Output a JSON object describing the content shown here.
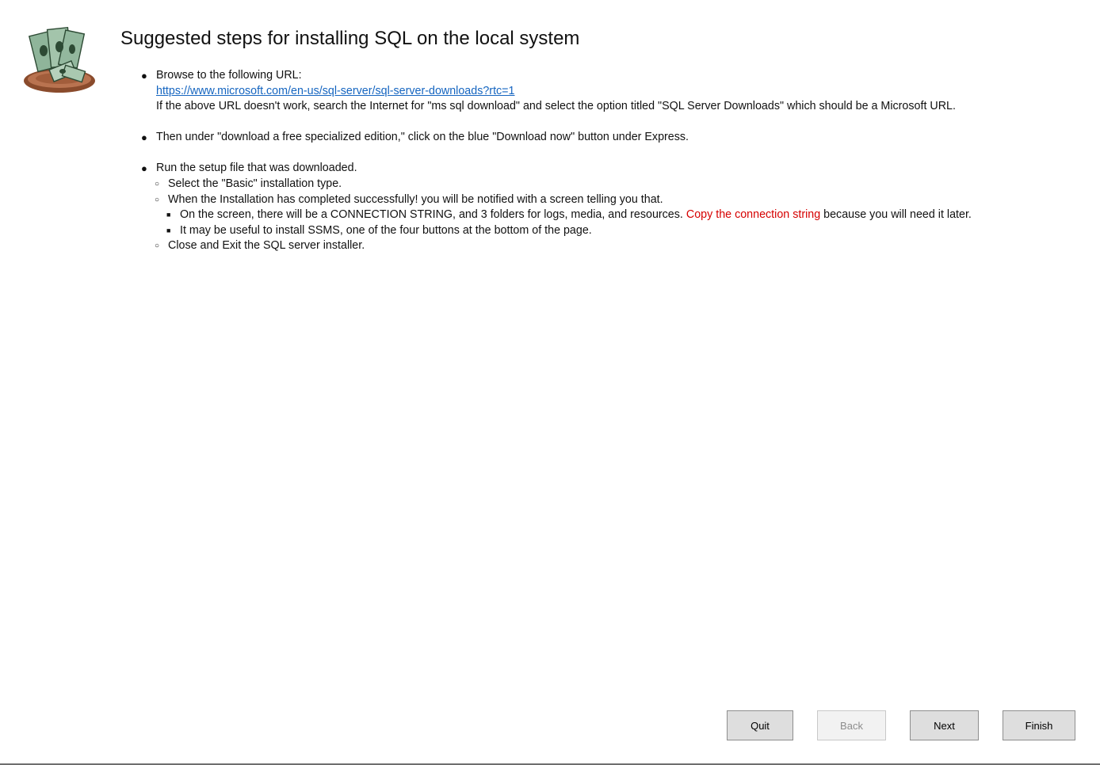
{
  "page": {
    "title": "Suggested steps for installing SQL on the local system"
  },
  "steps": {
    "browse_label": "Browse to the following URL:",
    "url": "https://www.microsoft.com/en-us/sql-server/sql-server-downloads?rtc=1",
    "fallback_note": "If the above URL doesn't work, search the Internet for \"ms sql download\" and select the option titled \"SQL Server Downloads\" which should be a Microsoft URL.",
    "download_instruction": "Then under \"download a free specialized edition,\" click on the blue \"Download now\" button under Express.",
    "run_setup": "Run the setup file that was downloaded.",
    "select_basic": "Select the \"Basic\" installation type.",
    "completed_note": "When the Installation has completed successfully! you will be notified with a screen telling you that.",
    "connection_prefix": "On the screen, there will be a CONNECTION STRING, and 3 folders for logs, media, and resources.",
    "connection_highlight": "Copy the connection string",
    "connection_suffix": "because you will need it later.",
    "ssms_note": "It may be useful to install SSMS, one of the four buttons at the bottom of the page.",
    "close_exit": "Close and Exit the SQL server installer."
  },
  "buttons": {
    "quit": "Quit",
    "back": "Back",
    "next": "Next",
    "finish": "Finish"
  },
  "colors": {
    "link": "#1565c0",
    "highlight": "#d60000",
    "button_bg": "#dedede",
    "button_disabled_text": "#8d8d8d"
  },
  "icons": {
    "logo": "money-bills-on-plate-icon"
  }
}
